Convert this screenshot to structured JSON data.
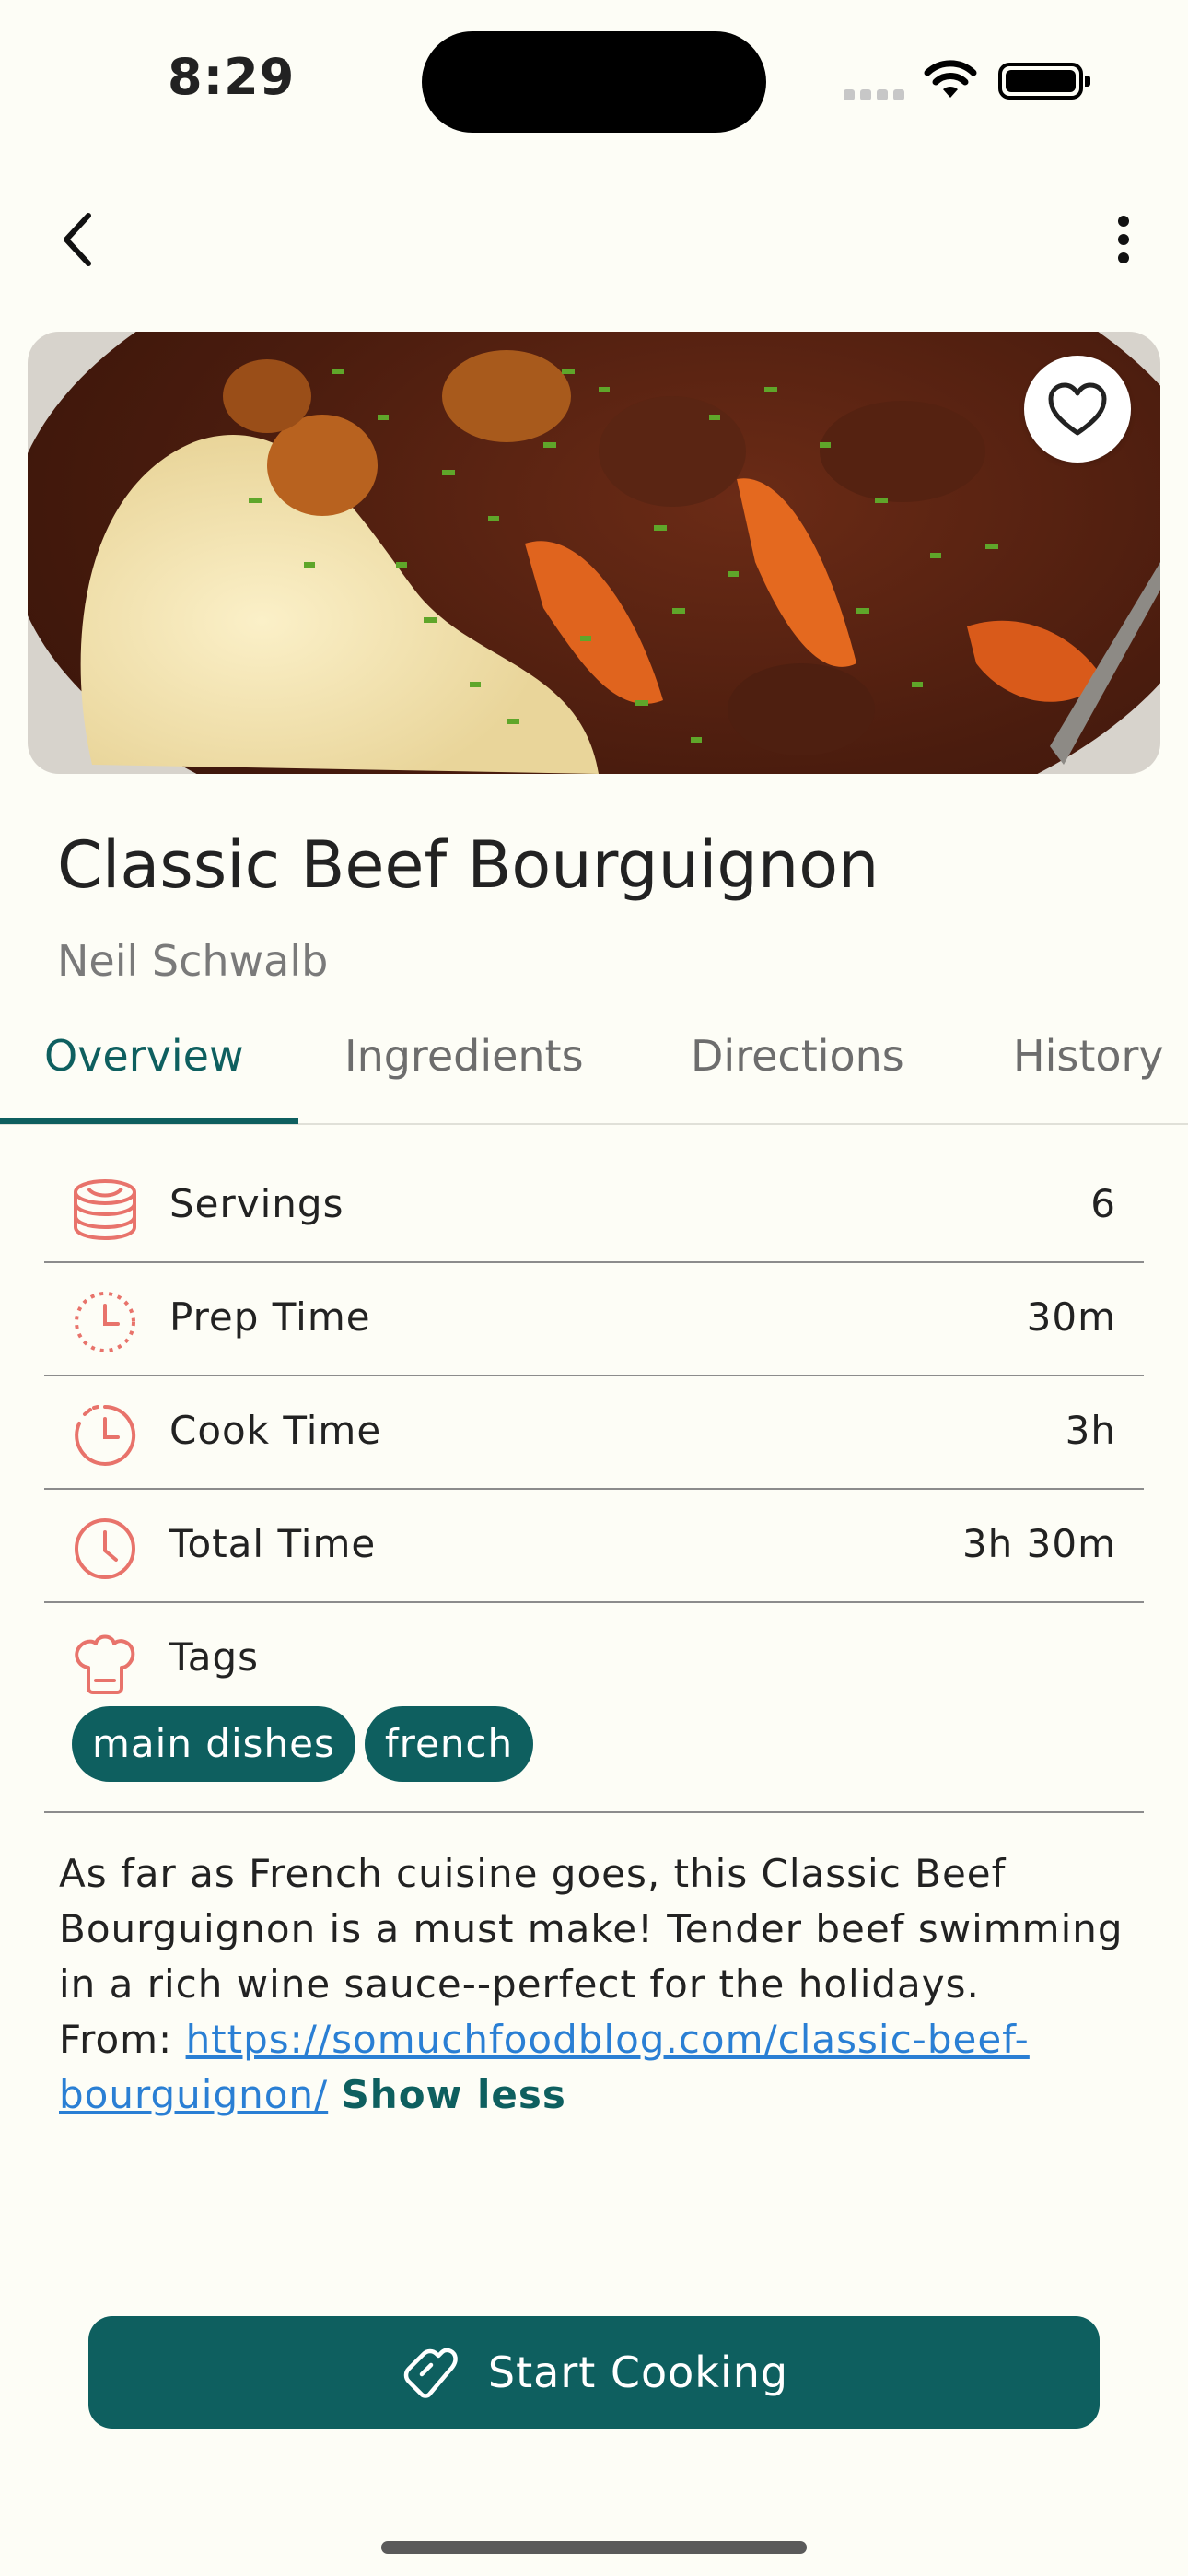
{
  "status_bar": {
    "time": "8:29"
  },
  "recipe": {
    "title": "Classic Beef Bourguignon",
    "author": "Neil Schwalb"
  },
  "tabs": [
    {
      "label": "Overview"
    },
    {
      "label": "Ingredients"
    },
    {
      "label": "Directions"
    },
    {
      "label": "History"
    }
  ],
  "details": {
    "servings": {
      "label": "Servings",
      "value": "6"
    },
    "prep_time": {
      "label": "Prep Time",
      "value": "30m"
    },
    "cook_time": {
      "label": "Cook Time",
      "value": "3h"
    },
    "total_time": {
      "label": "Total Time",
      "value": "3h 30m"
    },
    "tags": {
      "label": "Tags",
      "items": [
        "main dishes",
        "french"
      ]
    }
  },
  "description": {
    "text": "As far as French cuisine goes, this Classic Beef Bourguignon is a must make! Tender beef swimming in a rich wine sauce--perfect for the holidays.",
    "from_label": "From: ",
    "url": "https://somuchfoodblog.com/classic-beef-bourguignon/",
    "show_less": "Show less"
  },
  "actions": {
    "start_cooking": "Start Cooking"
  },
  "colors": {
    "accent": "#0E5F5F",
    "icon": "#E8736B",
    "background": "#FDFDF6",
    "link": "#2A7FD4"
  }
}
